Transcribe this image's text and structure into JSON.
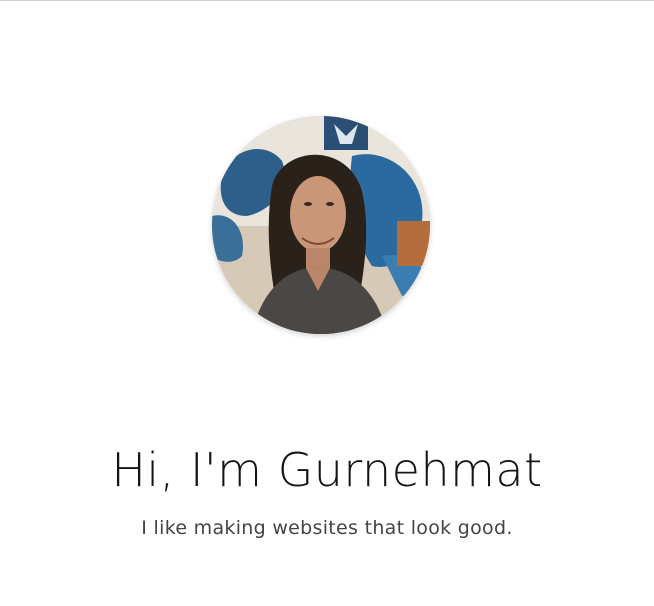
{
  "hero": {
    "greeting": "Hi, I'm Gurnehmat",
    "tagline": "I like making websites that look good.",
    "avatar_alt": "Profile photo of Gurnehmat"
  }
}
